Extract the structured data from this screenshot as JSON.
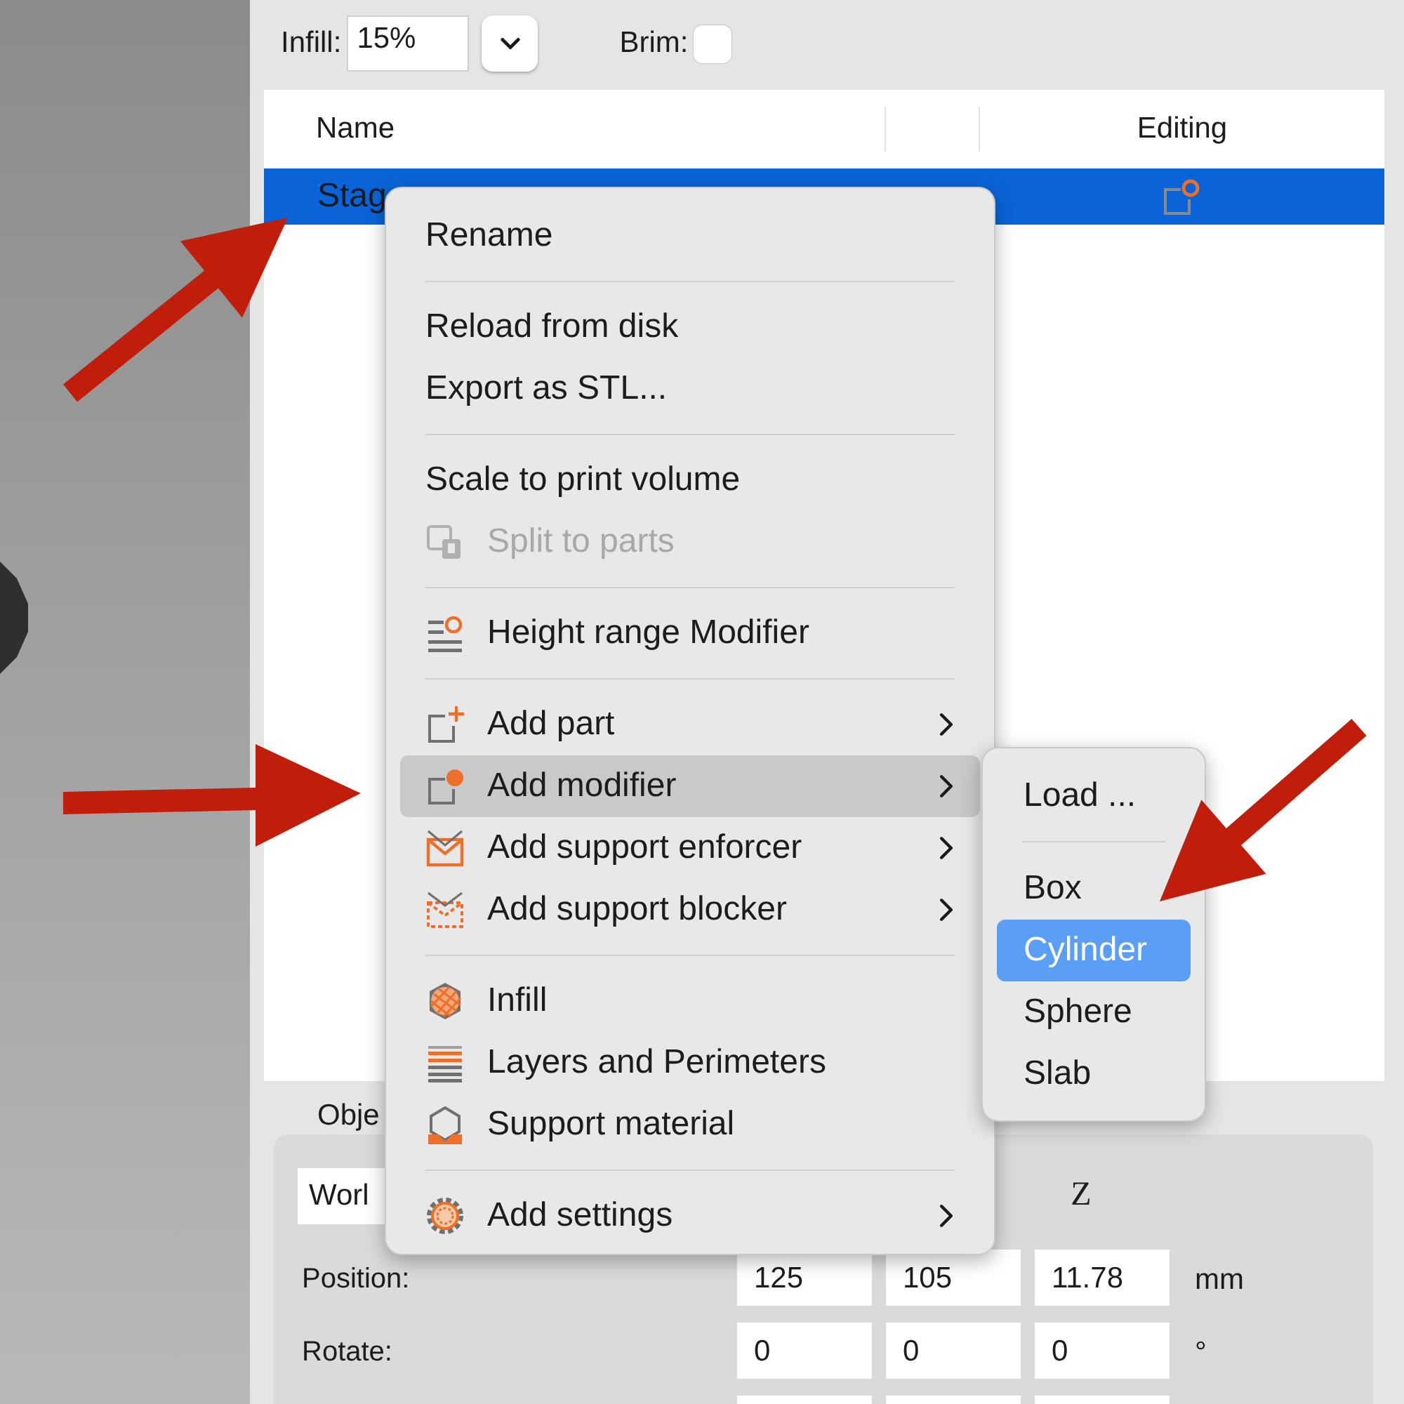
{
  "toolbar": {
    "infill_label": "Infill:",
    "infill_value": "15%",
    "brim_label": "Brim:",
    "brim_checked": false
  },
  "object_list": {
    "name_header": "Name",
    "editing_header": "Editing",
    "rows": [
      {
        "name": "Stag",
        "selected": true
      }
    ]
  },
  "context_menu": {
    "items": [
      {
        "kind": "plain",
        "label": "Rename",
        "disabled": false,
        "has_submenu": false,
        "selected": false
      },
      {
        "kind": "separator"
      },
      {
        "kind": "plain",
        "label": "Reload from disk",
        "disabled": false,
        "has_submenu": false,
        "selected": false
      },
      {
        "kind": "plain",
        "label": "Export as STL...",
        "disabled": false,
        "has_submenu": false,
        "selected": false
      },
      {
        "kind": "separator"
      },
      {
        "kind": "plain",
        "label": "Scale to print volume",
        "disabled": false,
        "has_submenu": false,
        "selected": false
      },
      {
        "kind": "split",
        "label": "Split to parts",
        "disabled": true,
        "has_submenu": false,
        "selected": false
      },
      {
        "kind": "separator"
      },
      {
        "kind": "height-range",
        "label": "Height range Modifier",
        "disabled": false,
        "has_submenu": false,
        "selected": false
      },
      {
        "kind": "separator"
      },
      {
        "kind": "part",
        "label": "Add part",
        "disabled": false,
        "has_submenu": true,
        "selected": false
      },
      {
        "kind": "modifier",
        "label": "Add modifier",
        "disabled": false,
        "has_submenu": true,
        "selected": true
      },
      {
        "kind": "enforcer",
        "label": "Add support enforcer",
        "disabled": false,
        "has_submenu": true,
        "selected": false
      },
      {
        "kind": "blocker",
        "label": "Add support blocker",
        "disabled": false,
        "has_submenu": true,
        "selected": false
      },
      {
        "kind": "separator"
      },
      {
        "kind": "infill",
        "label": "Infill",
        "disabled": false,
        "has_submenu": false,
        "selected": false
      },
      {
        "kind": "layers",
        "label": "Layers and Perimeters",
        "disabled": false,
        "has_submenu": false,
        "selected": false
      },
      {
        "kind": "support",
        "label": "Support material",
        "disabled": false,
        "has_submenu": false,
        "selected": false
      },
      {
        "kind": "separator"
      },
      {
        "kind": "settings",
        "label": "Add settings",
        "disabled": false,
        "has_submenu": true,
        "selected": false
      }
    ]
  },
  "submenu": {
    "items": [
      {
        "kind": "item",
        "label": "Load ...",
        "selected": false
      },
      {
        "kind": "separator"
      },
      {
        "kind": "item",
        "label": "Box",
        "selected": false
      },
      {
        "kind": "item",
        "label": "Cylinder",
        "selected": true
      },
      {
        "kind": "item",
        "label": "Sphere",
        "selected": false
      },
      {
        "kind": "item",
        "label": "Slab",
        "selected": false
      }
    ]
  },
  "object_manipulation": {
    "title": "Obje",
    "coordinate_system": "Worl",
    "axis_label": "Z",
    "rows": [
      {
        "label": "Position:",
        "values": [
          "125",
          "105",
          "11.78"
        ],
        "unit": "mm"
      },
      {
        "label": "Rotate:",
        "values": [
          "0",
          "0",
          "0"
        ],
        "unit": "°"
      }
    ]
  }
}
